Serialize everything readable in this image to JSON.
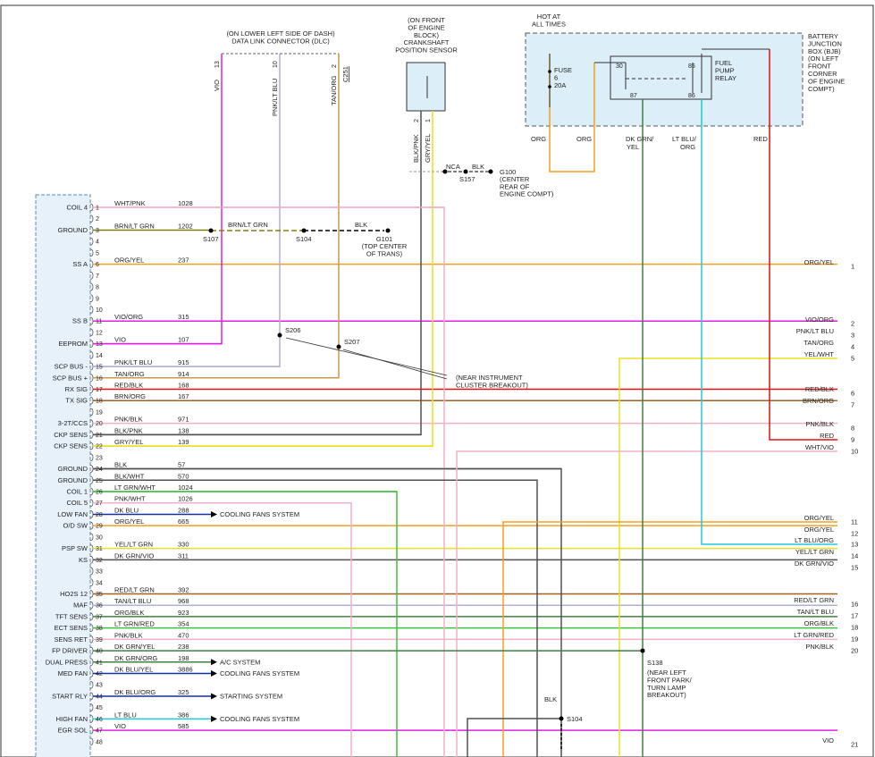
{
  "header": {
    "dlc_note": [
      "(ON LOWER LEFT SIDE OF DASH)",
      "DATA LINK CONNECTOR (DLC)"
    ],
    "ckp_note": [
      "(ON FRONT",
      "OF ENGINE",
      "BLOCK)",
      "CRANKSHAFT",
      "POSITION SENSOR"
    ],
    "hot_note": [
      "HOT AT",
      "ALL TIMES"
    ],
    "bjb_note": [
      "BATTERY",
      "JUNCTION",
      "BOX (BJB)",
      "(ON LEFT",
      "FRONT",
      "CORNER",
      "OF ENGINE",
      "COMPT)"
    ],
    "fuse": [
      "FUSE",
      "6",
      "20A"
    ],
    "relay": [
      "FUEL",
      "PUMP",
      "RELAY"
    ],
    "relay_pins": [
      "30",
      "85",
      "87",
      "86"
    ],
    "dlc_pins": [
      "13",
      "10",
      "2"
    ],
    "dlc_connector": "C251",
    "dlc_wires": [
      "VIO",
      "PNK/LT BLU",
      "TAN/ORG"
    ],
    "ckp_pins": [
      "2",
      "1"
    ],
    "ckp_wires": [
      "BLK/PNK",
      "GRY/YEL"
    ],
    "ckp_shield": "NCA",
    "ckp_ground_wire": "BLK",
    "splice_s157": "S157",
    "g100": [
      "G100",
      "(CENTER",
      "REAR OF",
      "ENGINE COMPT)"
    ],
    "top_wires": [
      "ORG",
      "ORG",
      "DK GRN/",
      "YEL",
      "LT BLU/",
      "ORG",
      "RED"
    ],
    "ground_splice": {
      "s107": "S107",
      "s104": "S104",
      "wire_mid": "BRN/LT GRN",
      "wire_blk": "BLK",
      "g101": [
        "G101",
        "(TOP CENTER",
        "OF TRANS)"
      ]
    },
    "s206": "S206",
    "s207": "S207",
    "near_ic": [
      "(NEAR INSTRUMENT",
      "CLUSTER BREAKOUT)"
    ],
    "s138": "S138",
    "near_park": [
      "(NEAR LEFT",
      "FRONT PARK/",
      "TURN LAMP",
      "BREAKOUT)"
    ],
    "s104_lower": "S104",
    "blk_lower": "BLK"
  },
  "pcm_pins": [
    {
      "pin": "1",
      "label": "COIL 4",
      "wire": "WHT/PNK",
      "circuit": "1028"
    },
    {
      "pin": "2",
      "label": "",
      "wire": "",
      "circuit": ""
    },
    {
      "pin": "3",
      "label": "GROUND",
      "wire": "BRN/LT GRN",
      "circuit": "1202"
    },
    {
      "pin": "4",
      "label": "",
      "wire": "",
      "circuit": ""
    },
    {
      "pin": "5",
      "label": "",
      "wire": "",
      "circuit": ""
    },
    {
      "pin": "6",
      "label": "SS A",
      "wire": "ORG/YEL",
      "circuit": "237"
    },
    {
      "pin": "7",
      "label": "",
      "wire": "",
      "circuit": ""
    },
    {
      "pin": "8",
      "label": "",
      "wire": "",
      "circuit": ""
    },
    {
      "pin": "9",
      "label": "",
      "wire": "",
      "circuit": ""
    },
    {
      "pin": "10",
      "label": "",
      "wire": "",
      "circuit": ""
    },
    {
      "pin": "11",
      "label": "SS B",
      "wire": "VIO/ORG",
      "circuit": "315"
    },
    {
      "pin": "12",
      "label": "",
      "wire": "",
      "circuit": ""
    },
    {
      "pin": "13",
      "label": "EEPROM",
      "wire": "VIO",
      "circuit": "107"
    },
    {
      "pin": "14",
      "label": "",
      "wire": "",
      "circuit": ""
    },
    {
      "pin": "15",
      "label": "SCP BUS -",
      "wire": "PNK/LT BLU",
      "circuit": "915"
    },
    {
      "pin": "16",
      "label": "SCP BUS +",
      "wire": "TAN/ORG",
      "circuit": "914"
    },
    {
      "pin": "17",
      "label": "RX SIG",
      "wire": "RED/BLK",
      "circuit": "168"
    },
    {
      "pin": "18",
      "label": "TX SIG",
      "wire": "BRN/ORG",
      "circuit": "167"
    },
    {
      "pin": "19",
      "label": "",
      "wire": "",
      "circuit": ""
    },
    {
      "pin": "20",
      "label": "3-2T/CCS",
      "wire": "PNK/BLK",
      "circuit": "971"
    },
    {
      "pin": "21",
      "label": "CKP SENS",
      "wire": "BLK/PNK",
      "circuit": "138"
    },
    {
      "pin": "22",
      "label": "CKP SENS",
      "wire": "GRY/YEL",
      "circuit": "139"
    },
    {
      "pin": "23",
      "label": "",
      "wire": "",
      "circuit": ""
    },
    {
      "pin": "24",
      "label": "GROUND",
      "wire": "BLK",
      "circuit": "57"
    },
    {
      "pin": "25",
      "label": "GROUND",
      "wire": "BLK/WHT",
      "circuit": "570"
    },
    {
      "pin": "26",
      "label": "COIL 1",
      "wire": "LT GRN/WHT",
      "circuit": "1024"
    },
    {
      "pin": "27",
      "label": "COIL 5",
      "wire": "PNK/WHT",
      "circuit": "1026"
    },
    {
      "pin": "28",
      "label": "LOW FAN",
      "wire": "DK BLU",
      "circuit": "288"
    },
    {
      "pin": "29",
      "label": "O/D SW",
      "wire": "ORG/YEL",
      "circuit": "665"
    },
    {
      "pin": "30",
      "label": "",
      "wire": "",
      "circuit": ""
    },
    {
      "pin": "31",
      "label": "PSP SW",
      "wire": "YEL/LT GRN",
      "circuit": "330"
    },
    {
      "pin": "32",
      "label": "KS",
      "wire": "DK GRN/VIO",
      "circuit": "311"
    },
    {
      "pin": "33",
      "label": "",
      "wire": "",
      "circuit": ""
    },
    {
      "pin": "34",
      "label": "",
      "wire": "",
      "circuit": ""
    },
    {
      "pin": "35",
      "label": "HO2S 12",
      "wire": "RED/LT GRN",
      "circuit": "392"
    },
    {
      "pin": "36",
      "label": "MAF",
      "wire": "TAN/LT BLU",
      "circuit": "968"
    },
    {
      "pin": "37",
      "label": "TFT SENS",
      "wire": "ORG/BLK",
      "circuit": "923"
    },
    {
      "pin": "38",
      "label": "ECT SENS",
      "wire": "LT GRN/RED",
      "circuit": "354"
    },
    {
      "pin": "39",
      "label": "SENS RET",
      "wire": "PNK/BLK",
      "circuit": "470"
    },
    {
      "pin": "40",
      "label": "FP DRIVER",
      "wire": "DK GRN/YEL",
      "circuit": "238"
    },
    {
      "pin": "41",
      "label": "DUAL PRESS",
      "wire": "DK GRN/ORG",
      "circuit": "198"
    },
    {
      "pin": "42",
      "label": "MED FAN",
      "wire": "DK BLU/YEL",
      "circuit": "3886"
    },
    {
      "pin": "43",
      "label": "",
      "wire": "",
      "circuit": ""
    },
    {
      "pin": "44",
      "label": "START RLY",
      "wire": "DK BLU/ORG",
      "circuit": "325"
    },
    {
      "pin": "45",
      "label": "",
      "wire": "",
      "circuit": ""
    },
    {
      "pin": "46",
      "label": "HIGH FAN",
      "wire": "LT BLU",
      "circuit": "386"
    },
    {
      "pin": "47",
      "label": "EGR SOL",
      "wire": "VIO",
      "circuit": "585"
    },
    {
      "pin": "48",
      "label": "",
      "wire": "",
      "circuit": ""
    }
  ],
  "system_refs": [
    {
      "pin": "28",
      "text": "COOLING FANS SYSTEM"
    },
    {
      "pin": "41",
      "text": "A/C SYSTEM"
    },
    {
      "pin": "42",
      "text": "COOLING FANS SYSTEM"
    },
    {
      "pin": "44",
      "text": "STARTING SYSTEM"
    },
    {
      "pin": "46",
      "text": "COOLING FANS SYSTEM"
    }
  ],
  "right_terminals": [
    {
      "num": "1",
      "wire": "ORG/YEL"
    },
    {
      "num": "2",
      "wire": "VIO/ORG"
    },
    {
      "num": "3",
      "wire": "PNK/LT BLU"
    },
    {
      "num": "4",
      "wire": "TAN/ORG"
    },
    {
      "num": "5",
      "wire": "YEL/WHT"
    },
    {
      "num": "6",
      "wire": "RED/BLK"
    },
    {
      "num": "7",
      "wire": "BRN/ORG"
    },
    {
      "num": "8",
      "wire": "PNK/BLK"
    },
    {
      "num": "9",
      "wire": "RED"
    },
    {
      "num": "10",
      "wire": "WHT/VIO"
    },
    {
      "num": "11",
      "wire": "ORG/YEL"
    },
    {
      "num": "12",
      "wire": "ORG/YEL"
    },
    {
      "num": "13",
      "wire": "LT BLU/ORG"
    },
    {
      "num": "14",
      "wire": "YEL/LT GRN"
    },
    {
      "num": "15",
      "wire": "DK GRN/VIO"
    },
    {
      "num": "16",
      "wire": "RED/LT GRN"
    },
    {
      "num": "17",
      "wire": "TAN/LT BLU"
    },
    {
      "num": "18",
      "wire": "ORG/BLK"
    },
    {
      "num": "19",
      "wire": "LT GRN/RED"
    },
    {
      "num": "20",
      "wire": "PNK/BLK"
    },
    {
      "num": "21",
      "wire": "VIO"
    }
  ],
  "colors": {
    "orange": "#f0a020",
    "magenta": "#e020e0",
    "pink": "#f0b0c8",
    "lavender": "#b0b0d8",
    "tan": "#c89850",
    "red": "#e01010",
    "brown": "#a06020",
    "dark_gray": "#505050",
    "green": "#40c040",
    "dark_green": "#408040",
    "yellow": "#e8e020",
    "cyan": "#20c8d8",
    "blue": "#1030a0",
    "olive": "#808010",
    "bjb_fill": "#dceef8"
  }
}
